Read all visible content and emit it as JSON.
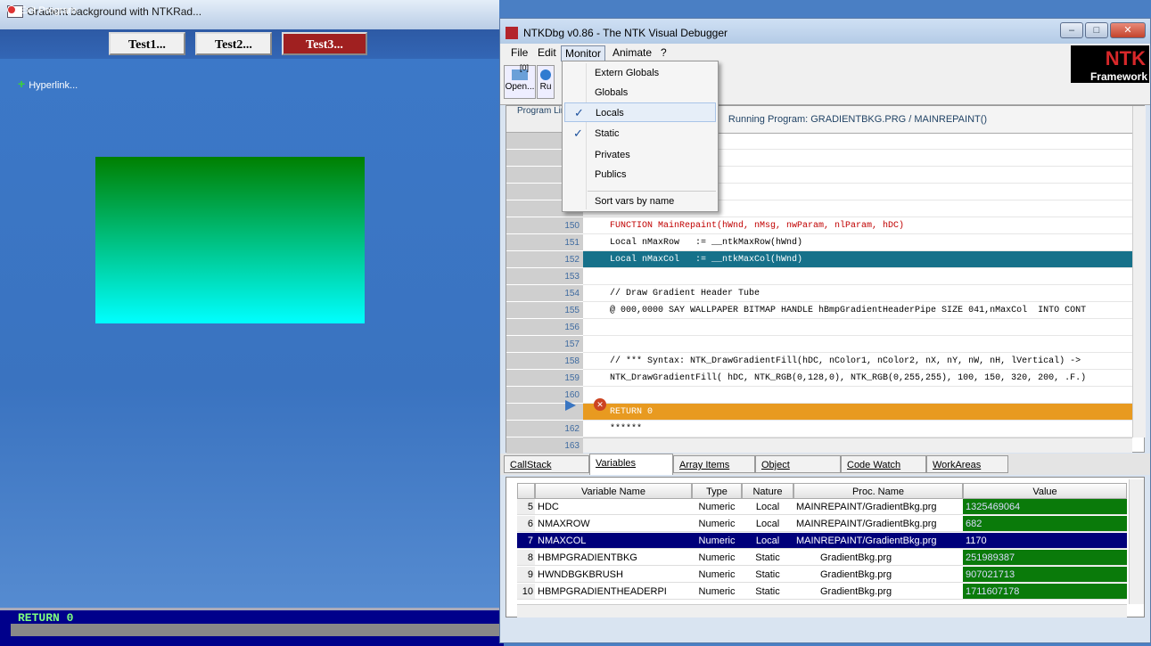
{
  "left_window": {
    "title": "Gradient background with NTKRad...",
    "exit_label": "Exit Program",
    "buttons": [
      "Test1...",
      "Test2...",
      "Test3..."
    ],
    "hyperlink": "Hyperlink...",
    "console": "RETURN 0"
  },
  "debugger": {
    "title": "NTKDbg v0.86 - The NTK Visual Debugger",
    "menu": [
      "File",
      "Edit",
      "Monitor",
      "Animate",
      "?"
    ],
    "toolbar": {
      "open_label": "Open...",
      "run_label": "Ru",
      "badge": "[0]"
    },
    "logo": {
      "main": "NTK",
      "sub": "Framework"
    },
    "code_header_left": "Program Lines",
    "code_header_right": "Running Program: GRADIENTBKG.PRG / MAINREPAINT()",
    "code_lines": [
      {
        "num": "150",
        "text": "FUNCTION MainRepaint(hWnd, nMsg, nwParam, nlParam, hDC)",
        "style": "fn"
      },
      {
        "num": "151",
        "text": "Local nMaxRow   := __ntkMaxRow(hWnd)",
        "style": ""
      },
      {
        "num": "152",
        "text": "Local nMaxCol   := __ntkMaxCol(hWnd)",
        "style": "hl"
      },
      {
        "num": "153",
        "text": "",
        "style": ""
      },
      {
        "num": "154",
        "text": "// Draw Gradient Header Tube",
        "style": ""
      },
      {
        "num": "155",
        "text": "@ 000,0000 SAY WALLPAPER BITMAP HANDLE hBmpGradientHeaderPipe SIZE 041,nMaxCol  INTO CONT",
        "style": ""
      },
      {
        "num": "156",
        "text": "",
        "style": ""
      },
      {
        "num": "157",
        "text": "",
        "style": ""
      },
      {
        "num": "158",
        "text": "// *** Syntax: NTK_DrawGradientFill(hDC, nColor1, nColor2, nX, nY, nW, nH, lVertical) ->",
        "style": ""
      },
      {
        "num": "159",
        "text": "NTK_DrawGradientFill( hDC, NTK_RGB(0,128,0), NTK_RGB(0,255,255), 100, 150, 320, 200, .F.)",
        "style": ""
      },
      {
        "num": "160",
        "text": "",
        "style": ""
      },
      {
        "num": "",
        "text": "RETURN 0",
        "style": "bp"
      },
      {
        "num": "162",
        "text": "******",
        "style": ""
      },
      {
        "num": "163",
        "text": "******",
        "style": ""
      }
    ],
    "monitor_menu": [
      {
        "label": "Extern Globals",
        "checked": false,
        "selected": false
      },
      {
        "label": "Globals",
        "checked": false,
        "selected": false
      },
      {
        "label": "Locals",
        "checked": true,
        "selected": true
      },
      {
        "label": "Static",
        "checked": true,
        "selected": false
      },
      {
        "label": "Privates",
        "checked": false,
        "selected": false
      },
      {
        "label": "Publics",
        "checked": false,
        "selected": false
      },
      {
        "label": "Sort vars by name",
        "checked": false,
        "selected": false
      }
    ],
    "tabs": [
      "CallStack",
      "Variables",
      "Array Items",
      "Object Properties",
      "Code Watch",
      "WorkAreas"
    ],
    "active_tab": "Variables",
    "var_columns": [
      "",
      "Variable Name",
      "Type",
      "Nature",
      "Proc. Name",
      "Value"
    ],
    "var_rows": [
      {
        "n": "5",
        "name": "HDC",
        "type": "Numeric",
        "nature": "Local",
        "proc": "MAINREPAINT/GradientBkg.prg",
        "value": "1325469064"
      },
      {
        "n": "6",
        "name": "NMAXROW",
        "type": "Numeric",
        "nature": "Local",
        "proc": "MAINREPAINT/GradientBkg.prg",
        "value": "682"
      },
      {
        "n": "7",
        "name": "NMAXCOL",
        "type": "Numeric",
        "nature": "Local",
        "proc": "MAINREPAINT/GradientBkg.prg",
        "value": "1170"
      },
      {
        "n": "8",
        "name": "HBMPGRADIENTBKG",
        "type": "Numeric",
        "nature": "Static",
        "proc": "GradientBkg.prg",
        "value": "251989387"
      },
      {
        "n": "9",
        "name": "HWNDBGKBRUSH",
        "type": "Numeric",
        "nature": "Static",
        "proc": "GradientBkg.prg",
        "value": "907021713"
      },
      {
        "n": "10",
        "name": "HBMPGRADIENTHEADERPI",
        "type": "Numeric",
        "nature": "Static",
        "proc": "GradientBkg.prg",
        "value": "1711607178"
      }
    ],
    "selected_var_row": 2,
    "colors": {
      "highlight_line": "#16718a",
      "breakpoint_line": "#e89a20",
      "value_cell": "#0a7a0a",
      "selected_row": "#00007a"
    }
  }
}
